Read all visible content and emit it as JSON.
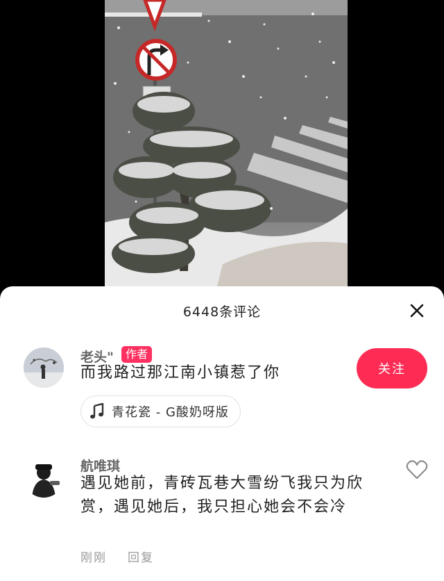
{
  "sheet": {
    "title": "6448条评论"
  },
  "comments": [
    {
      "username": "老头\"",
      "badge": "作者",
      "text": "而我路过那江南小镇惹了你",
      "follow_label": "关注",
      "music": {
        "icon": "music-note-icon",
        "label": "青花瓷 - G酸奶呀版"
      }
    },
    {
      "username": "航唯琪",
      "text": "遇见她前，青砖瓦巷大雪纷飞我只为欣赏，遇见她后，我只担心她会不会冷",
      "time": "刚刚",
      "reply_label": "回复"
    }
  ],
  "colors": {
    "accent": "#fe2c55",
    "badge": "#ff3160"
  }
}
